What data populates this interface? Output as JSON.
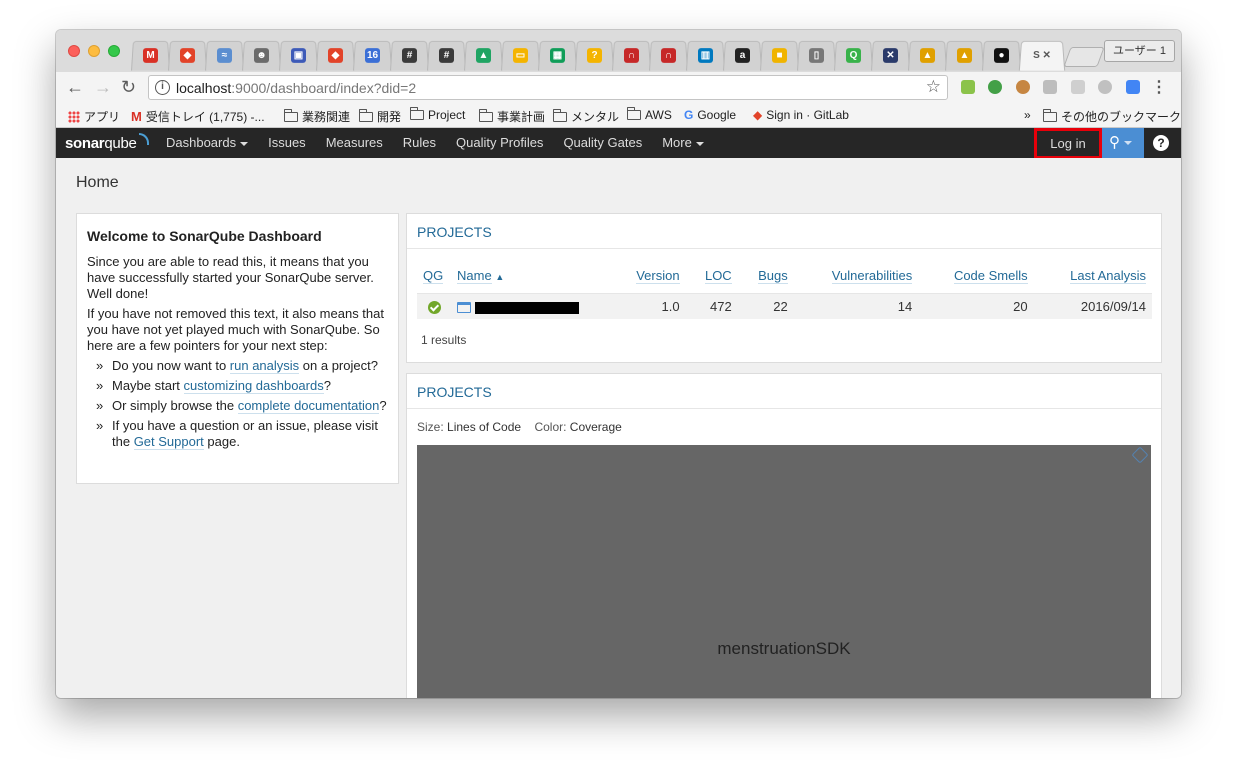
{
  "browser": {
    "tabs": [
      {
        "icon": "gmail-icon",
        "glyph": "M",
        "color": "#d93025"
      },
      {
        "icon": "gitlab-icon",
        "glyph": "◆",
        "color": "#e24329"
      },
      {
        "icon": "feed-icon",
        "glyph": "≈",
        "color": "#5b8ed0"
      },
      {
        "icon": "jenkins-icon",
        "glyph": "☻",
        "color": "#6b6b6b"
      },
      {
        "icon": "note-icon",
        "glyph": "▣",
        "color": "#3d5ab8"
      },
      {
        "icon": "gitlab-icon",
        "glyph": "◆",
        "color": "#e24329"
      },
      {
        "icon": "calendar-icon",
        "glyph": "16",
        "color": "#3b6fd6"
      },
      {
        "icon": "slack-icon",
        "glyph": "#",
        "color": "#3a3a3a"
      },
      {
        "icon": "slack-icon",
        "glyph": "#",
        "color": "#3a3a3a"
      },
      {
        "icon": "drive-icon",
        "glyph": "▲",
        "color": "#1fa463"
      },
      {
        "icon": "slides-icon",
        "glyph": "▭",
        "color": "#f4b400"
      },
      {
        "icon": "sheets-icon",
        "glyph": "▦",
        "color": "#0f9d58"
      },
      {
        "icon": "keep-icon",
        "glyph": "?",
        "color": "#f4b400"
      },
      {
        "icon": "arc-icon",
        "glyph": "∩",
        "color": "#c62828"
      },
      {
        "icon": "arc-icon",
        "glyph": "∩",
        "color": "#c62828"
      },
      {
        "icon": "trello-icon",
        "glyph": "▥",
        "color": "#0079bf"
      },
      {
        "icon": "amazon-icon",
        "glyph": "a",
        "color": "#222222"
      },
      {
        "icon": "box-icon",
        "glyph": "■",
        "color": "#f0b400"
      },
      {
        "icon": "page-icon",
        "glyph": "▯",
        "color": "#777777"
      },
      {
        "icon": "search-q-icon",
        "glyph": "Q",
        "color": "#38b24a"
      },
      {
        "icon": "scissors-icon",
        "glyph": "✕",
        "color": "#2a3a6a"
      },
      {
        "icon": "app-icon",
        "glyph": "▲",
        "color": "#e0a000"
      },
      {
        "icon": "app-icon",
        "glyph": "▲",
        "color": "#e0a000"
      },
      {
        "icon": "github-icon",
        "glyph": "●",
        "color": "#111111"
      }
    ],
    "active_tab": {
      "text": "S",
      "close": "✕"
    },
    "profile": "ユーザー 1",
    "url_host": "localhost",
    "url_path": ":9000/dashboard/index?did=2",
    "bookmarks": [
      {
        "label": "アプリ",
        "icon": "apps-icon"
      },
      {
        "label": "受信トレイ (1,775) -...",
        "icon": "gmail-icon"
      },
      {
        "label": "業務関連",
        "icon": "folder-icon"
      },
      {
        "label": "開発",
        "icon": "folder-icon"
      },
      {
        "label": "Project",
        "icon": "folder-icon"
      },
      {
        "label": "事業計画",
        "icon": "folder-icon"
      },
      {
        "label": "メンタル",
        "icon": "folder-icon"
      },
      {
        "label": "AWS",
        "icon": "folder-icon"
      },
      {
        "label": "Google",
        "icon": "google-icon"
      },
      {
        "label": "Sign in · GitLab",
        "icon": "gitlab-icon"
      }
    ],
    "other_bookmarks": "その他のブックマーク",
    "bookmarks_overflow": "»"
  },
  "sonar": {
    "logo_main": "sonar",
    "logo_sub": "qube",
    "nav": [
      {
        "label": "Dashboards",
        "dropdown": true
      },
      {
        "label": "Issues",
        "dropdown": false
      },
      {
        "label": "Measures",
        "dropdown": false
      },
      {
        "label": "Rules",
        "dropdown": false
      },
      {
        "label": "Quality Profiles",
        "dropdown": false
      },
      {
        "label": "Quality Gates",
        "dropdown": false
      },
      {
        "label": "More",
        "dropdown": true
      }
    ],
    "login": "Log in",
    "help": "?"
  },
  "page": {
    "title": "Home",
    "welcome": {
      "heading": "Welcome to SonarQube Dashboard",
      "p1": "Since you are able to read this, it means that you have successfully started your SonarQube server. Well done!",
      "p2": "If you have not removed this text, it also means that you have not yet played much with SonarQube. So here are a few pointers for your next step:",
      "b1_pre": "Do you now want to ",
      "b1_link": "run analysis",
      "b1_post": " on a project?",
      "b2_pre": "Maybe start ",
      "b2_link": "customizing dashboards",
      "b2_post": "?",
      "b3_pre": "Or simply browse the ",
      "b3_link": "complete documentation",
      "b3_post": "?",
      "b4_pre": "If you have a question or an issue, please visit the ",
      "b4_link": "Get Support",
      "b4_post": " page."
    },
    "projects_table": {
      "title": "PROJECTS",
      "columns": [
        "QG",
        "Name",
        "Version",
        "LOC",
        "Bugs",
        "Vulnerabilities",
        "Code Smells",
        "Last Analysis"
      ],
      "sort_indicator": "▲",
      "rows": [
        {
          "qg": "passed",
          "name": "",
          "version": "1.0",
          "loc": "472",
          "bugs": "22",
          "vulnerabilities": "14",
          "code_smells": "20",
          "last_analysis": "2016/09/14"
        }
      ],
      "results": "1 results"
    },
    "projects_treemap": {
      "title": "PROJECTS",
      "size_label": "Size:",
      "size_value": "Lines of Code",
      "color_label": "Color:",
      "color_value": "Coverage",
      "tile_label": "menstruationSDK",
      "tile_color": "#666666"
    }
  }
}
